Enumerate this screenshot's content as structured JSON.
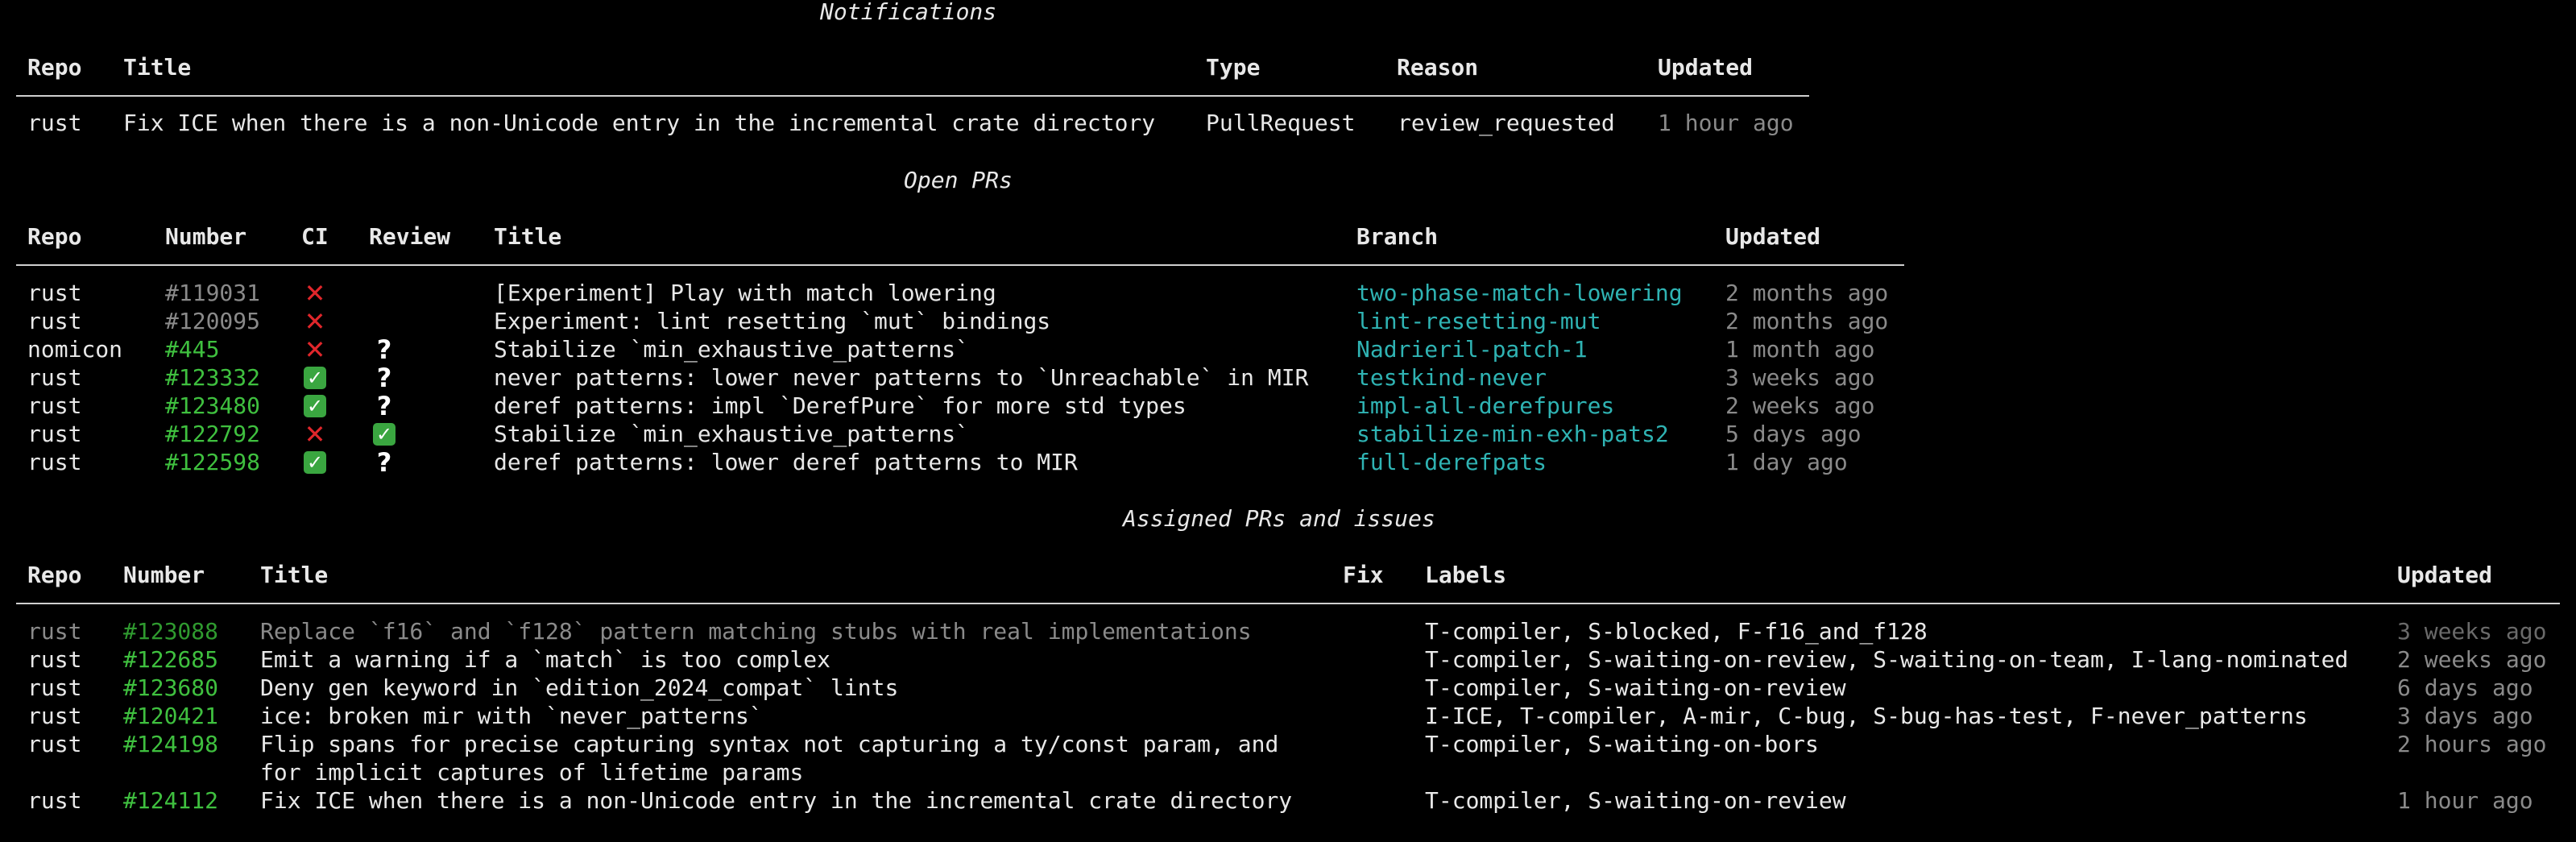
{
  "notifications": {
    "title": "Notifications",
    "headers": [
      "Repo",
      "Title",
      "Type",
      "Reason",
      "Updated"
    ],
    "rows": [
      [
        "rust",
        "Fix ICE when there is a non-Unicode entry in the incremental crate directory",
        "PullRequest",
        "review_requested",
        "1 hour ago"
      ]
    ]
  },
  "open_prs": {
    "title": "Open PRs",
    "headers": [
      "Repo",
      "Number",
      "CI",
      "Review",
      "Title",
      "Branch",
      "Updated"
    ],
    "rows": [
      [
        "rust",
        "#119031",
        "[Experiment] Play with match lowering",
        "two-phase-match-lowering",
        "2 months ago"
      ],
      [
        "rust",
        "#120095",
        "Experiment: lint resetting `mut` bindings",
        "lint-resetting-mut",
        "2 months ago"
      ],
      [
        "nomicon",
        "#445",
        "Stabilize `min_exhaustive_patterns`",
        "Nadrieril-patch-1",
        "1 month ago"
      ],
      [
        "rust",
        "#123332",
        "never patterns: lower never patterns to `Unreachable` in MIR",
        "testkind-never",
        "3 weeks ago"
      ],
      [
        "rust",
        "#123480",
        "deref patterns: impl `DerefPure` for more std types",
        "impl-all-derefpures",
        "2 weeks ago"
      ],
      [
        "rust",
        "#122792",
        "Stabilize `min_exhaustive_patterns`",
        "stabilize-min-exh-pats2",
        "5 days ago"
      ],
      [
        "rust",
        "#122598",
        "deref patterns: lower deref patterns to MIR",
        "full-derefpats",
        "1 day ago"
      ]
    ],
    "ci_icons": [
      "cross-mark-icon",
      "cross-mark-icon",
      "cross-mark-icon",
      "check-mark-icon",
      "check-mark-icon",
      "cross-mark-icon",
      "check-mark-icon"
    ],
    "review_icons": [
      "",
      "",
      "question-mark-icon",
      "question-mark-icon",
      "question-mark-icon",
      "check-mark-icon",
      "question-mark-icon"
    ]
  },
  "assigned": {
    "title": "Assigned PRs and issues",
    "headers": [
      "Repo",
      "Number",
      "Title",
      "Fix",
      "Labels",
      "Updated"
    ],
    "rows": [
      [
        "rust",
        "#123088",
        "Replace `f16` and `f128` pattern matching stubs with real implementations",
        "",
        "T-compiler, S-blocked, F-f16_and_f128",
        "3 weeks ago"
      ],
      [
        "rust",
        "#122685",
        "Emit a warning if a `match` is too complex",
        "",
        "T-compiler, S-waiting-on-review, S-waiting-on-team, I-lang-nominated",
        "2 weeks ago"
      ],
      [
        "rust",
        "#123680",
        "Deny gen keyword in `edition_2024_compat` lints",
        "",
        "T-compiler, S-waiting-on-review",
        "6 days ago"
      ],
      [
        "rust",
        "#120421",
        "ice: broken mir with `never_patterns`",
        "",
        "I-ICE, T-compiler, A-mir, C-bug, S-bug-has-test, F-never_patterns",
        "3 days ago"
      ],
      [
        "rust",
        "#124198",
        "Flip spans for precise capturing syntax not capturing a ty/const param, and",
        "",
        "T-compiler, S-waiting-on-bors",
        "2 hours ago"
      ],
      [
        "",
        "",
        "for implicit captures of lifetime params",
        "",
        "",
        ""
      ],
      [
        "rust",
        "#124112",
        "Fix ICE when there is a non-Unicode entry in the incremental crate directory",
        "",
        "T-compiler, S-waiting-on-review",
        "1 hour ago"
      ]
    ]
  },
  "colors": {
    "background": "#000000",
    "text": "#e8e8e8",
    "dim": "#8a8a8a",
    "number_green": "#3fc03f",
    "branch_cyan": "#2fb3b3",
    "ci_fail": "#e0262b",
    "ci_pass": "#3aa640"
  }
}
